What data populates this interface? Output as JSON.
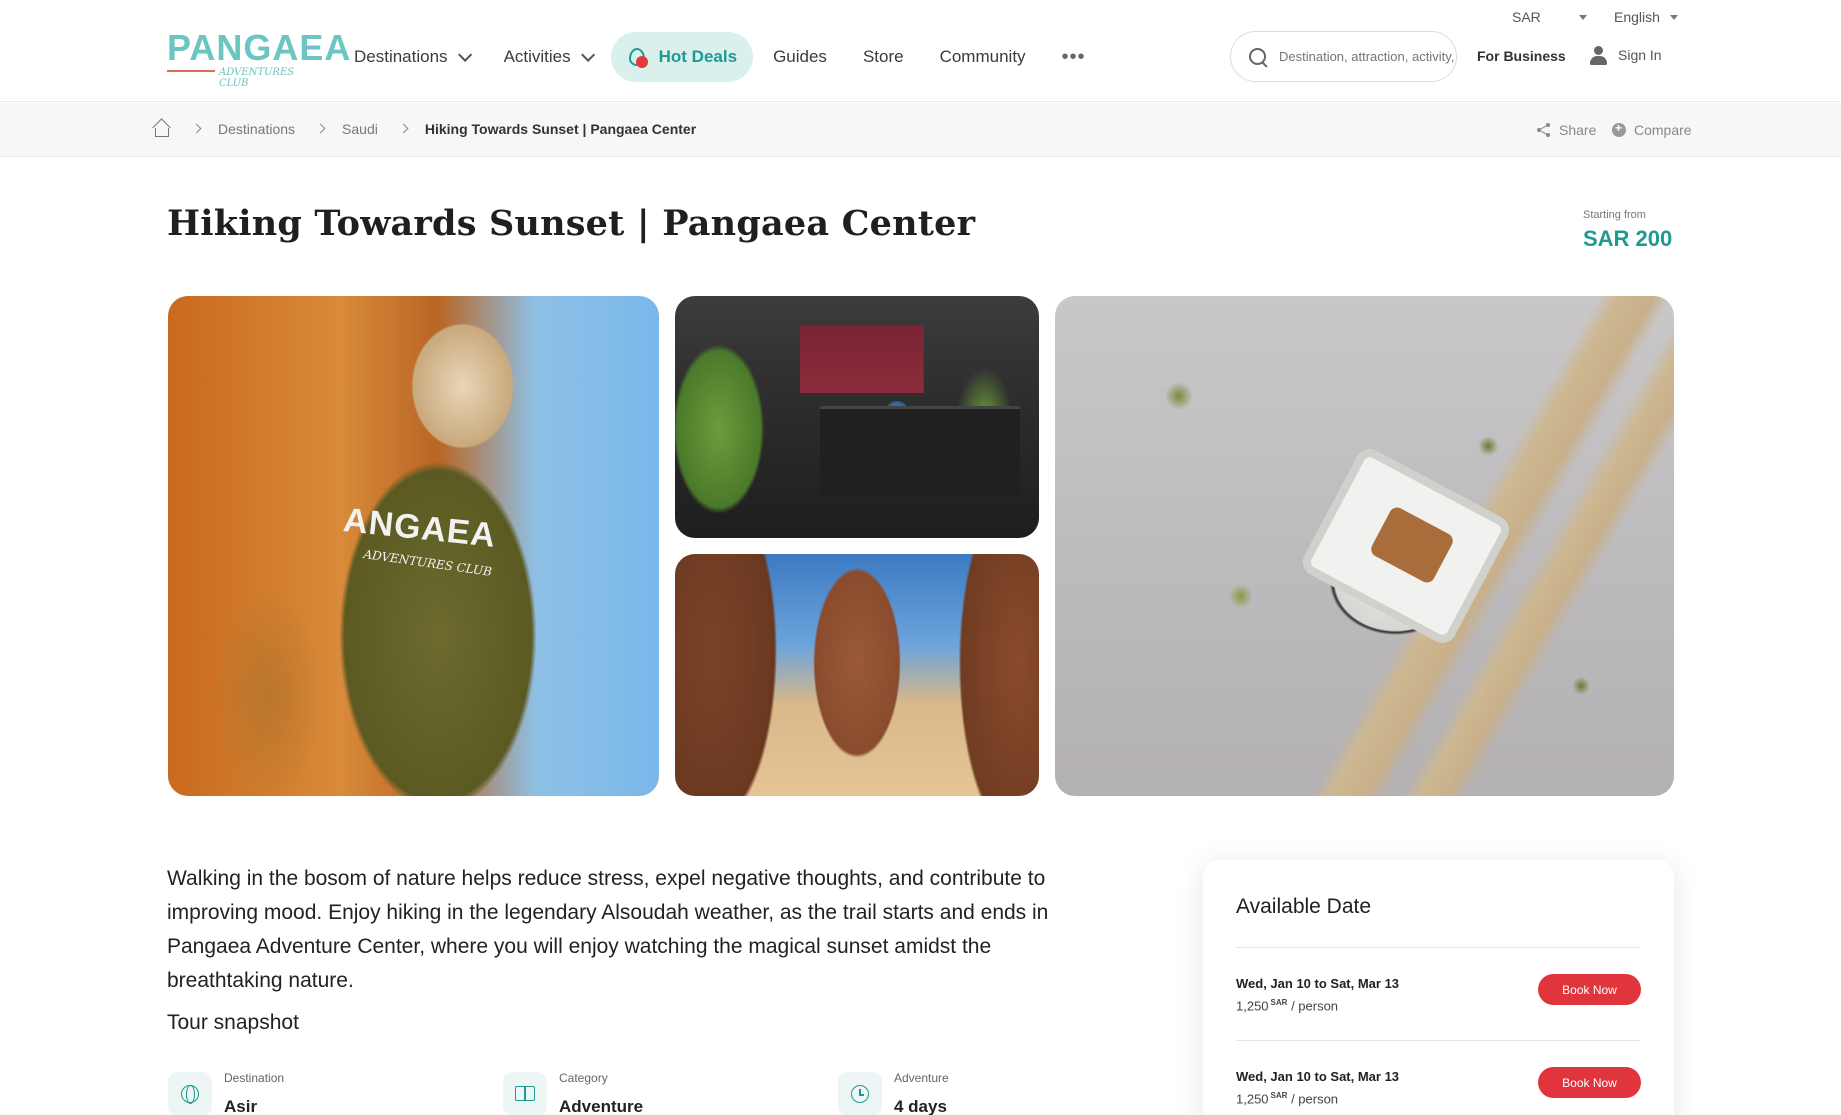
{
  "header": {
    "logo_text": "PANGAEA",
    "logo_sub": "ADVENTURES CLUB",
    "nav": [
      {
        "label": "Destinations"
      },
      {
        "label": "Activities"
      },
      {
        "label": "Hot Deals"
      },
      {
        "label": "Guides"
      },
      {
        "label": "Store"
      },
      {
        "label": "Community"
      },
      {
        "label": "•••"
      }
    ],
    "search_placeholder": "Destination, attraction, activity, etc",
    "for_business": "For Business",
    "sign_in": "Sign In",
    "currency": "SAR",
    "language": "English"
  },
  "breadcrumb": {
    "items": [
      "Destinations",
      "Saudi",
      "Hiking Towards Sunset | Pangaea Center"
    ],
    "share": "Share",
    "compare": "Compare"
  },
  "page": {
    "title": "Hiking Towards Sunset | Pangaea Center",
    "price_label": "Starting from",
    "price": "SAR 200"
  },
  "gallery": {
    "vest_text": "ANGAEA",
    "vest_sub": "ADVENTURES CLUB"
  },
  "description": "Walking in the bosom of nature helps reduce stress, expel negative thoughts, and contribute to improving mood. Enjoy hiking in the legendary Alsoudah weather, as the trail starts and ends in Pangaea Adventure Center, where you will enjoy watching the magical sunset amidst the breathtaking nature.",
  "snapshot": {
    "title": "Tour snapshot",
    "items": [
      {
        "label": "Destination",
        "value": "Asir",
        "icon": "globe-icon"
      },
      {
        "label": "Category",
        "value": "Adventure",
        "icon": "book-icon"
      },
      {
        "label": "Adventure",
        "value": "4 days",
        "icon": "clock-icon"
      }
    ]
  },
  "availability": {
    "title": "Available Date",
    "slots": [
      {
        "dates": "Wed, Jan 10 to Sat, Mar 13",
        "price": "1,250",
        "currency": "SAR",
        "unit": "/ person",
        "button": "Book Now"
      },
      {
        "dates": "Wed, Jan 10 to Sat, Mar 13",
        "price": "1,250",
        "currency": "SAR",
        "unit": "/ person",
        "button": "Book Now"
      }
    ]
  },
  "colors": {
    "brand_teal": "#1e9a90",
    "book_red": "#e0353d",
    "hot_deals_bg": "#d9f0ed"
  }
}
